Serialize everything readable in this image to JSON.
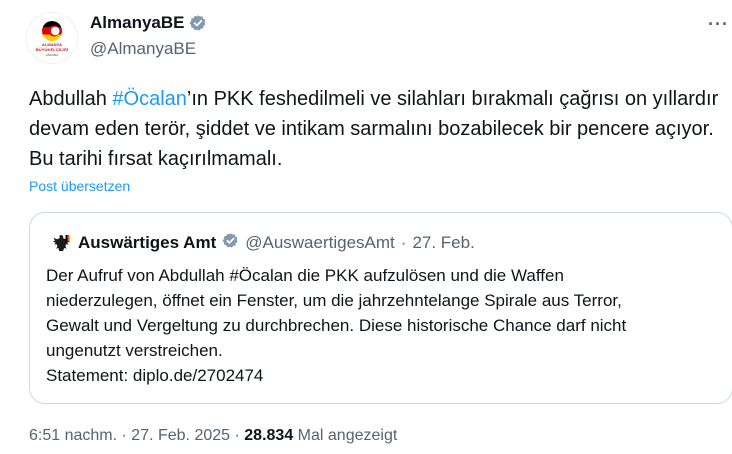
{
  "author": {
    "display_name": "AlmanyaBE",
    "handle": "@AlmanyaBE",
    "avatar_text": "ALMANYA BÜYÜKELÇİLİĞİ",
    "avatar_sub": "ANKARA"
  },
  "more_label": "···",
  "tweet": {
    "text_before": "Abdullah ",
    "hashtag": "#Öcalan",
    "text_after": "’ın PKK feshedilmeli ve silahları bırakmalı çağrısı on yıllardır devam eden terör, şiddet ve intikam sarmalını bozabilecek bir pencere açıyor. Bu tarihi fırsat kaçırılmamalı.",
    "translate_label": "Post übersetzen"
  },
  "quote": {
    "display_name": "Auswärtiges Amt",
    "handle": "@AuswaertigesAmt",
    "separator": "·",
    "date": "27. Feb.",
    "text": "Der Aufruf von Abdullah #Öcalan die PKK aufzulösen und die Waffen\nniederzulegen, öffnet ein Fenster, um die jahrzehntelange Spirale aus Terror,\nGewalt und Vergeltung zu durchbrechen. Diese historische Chance darf nicht\nungenutzt verstreichen.\nStatement: diplo.de/2702474"
  },
  "meta": {
    "time": "6:51 nachm.",
    "sep1": "·",
    "date": "27. Feb. 2025",
    "sep2": "·",
    "views": "28.834",
    "views_label": "Mal angezeigt"
  },
  "colors": {
    "accent": "#1d9bf0",
    "verified_gray": "#829aab",
    "text": "#0f1419",
    "secondary": "#536471",
    "border": "#cfd9de"
  }
}
